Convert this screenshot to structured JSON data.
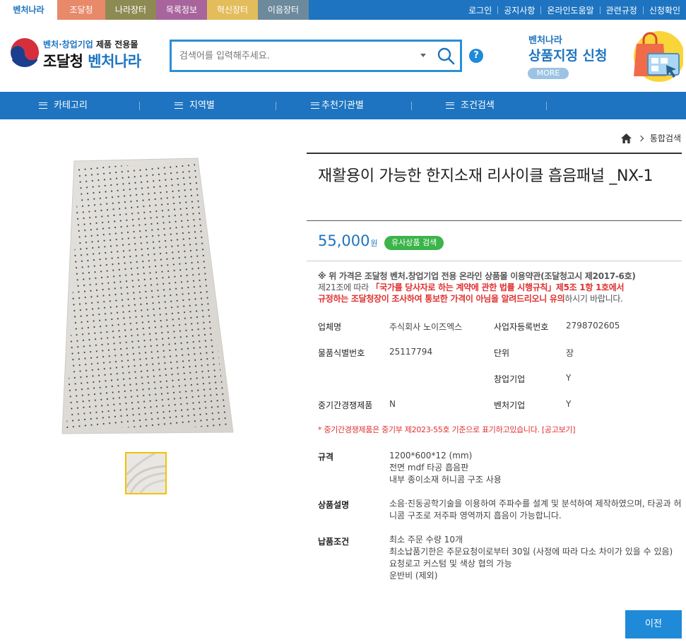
{
  "site_tabs": [
    {
      "label": "벤처나라",
      "color": "#ffffff",
      "active": true
    },
    {
      "label": "조달청",
      "color": "#e8896a"
    },
    {
      "label": "나라장터",
      "color": "#8e8a54"
    },
    {
      "label": "목록정보",
      "color": "#a8649c"
    },
    {
      "label": "혁신장터",
      "color": "#e3bd5c"
    },
    {
      "label": "이음장터",
      "color": "#6d8a9c"
    }
  ],
  "top_links": [
    "로그인",
    "공지사항",
    "온라인도움말",
    "관련규정",
    "신청확인"
  ],
  "logo": {
    "sub_prefix": "벤처·창업기업",
    "sub_suffix": "제품 전용몰",
    "main_prefix": "조달청",
    "main_suffix": "벤처나라"
  },
  "search": {
    "placeholder": "검색어를 입력해주세요.",
    "value": ""
  },
  "help_label": "?",
  "promo": {
    "small": "벤처나라",
    "big": "상품지정 신청",
    "more": "MORE"
  },
  "nav": [
    {
      "label": "카테고리"
    },
    {
      "label": "지역별"
    },
    {
      "label": "추천기관별"
    },
    {
      "label": "조건검색"
    }
  ],
  "breadcrumb": {
    "current": "통합검색"
  },
  "product": {
    "title": "재활용이 가능한 한지소재 리사이클 흡음패널 _NX-1",
    "price": "55,000",
    "price_unit": "원",
    "similar_button": "유사상품 검색"
  },
  "notice": {
    "p1": "※ 위 가격은 조달청 벤처.창업기업 전용 온라인 상품몰 이용약관(조달청고시 제2017-6호)",
    "p2a": "제21조에 따라 ",
    "p2b": "「국가를 당사자로 하는 계약에 관한 법률 시행규칙」제5조 1항 1호에서",
    "p3a": "규정하는 조달청장이 조사하여 통보한 가격이 아님을 알려드리오니 유의",
    "p3b": "하시기 바랍니다."
  },
  "specs": {
    "company_label": "업체명",
    "company_value": "주식회사 노이즈엑스",
    "bizno_label": "사업자등록번호",
    "bizno_value": "2798702605",
    "itemno_label": "물품식별번호",
    "itemno_value": "25117794",
    "unit_label": "단위",
    "unit_value": "장",
    "startup_label": "창업기업",
    "startup_value": "Y",
    "competition_label": "중기간경쟁제품",
    "competition_value": "N",
    "venture_label": "벤처기업",
    "venture_value": "Y"
  },
  "red_note": "* 중기간경쟁제품은 중기부 제2023-55호 기준으로 표기하고있습니다. [공고보기]",
  "details": {
    "spec_label": "규격",
    "spec_lines": [
      "1200*600*12 (mm)",
      "전면 mdf 타공 흡음판",
      "내부 종이소재 허니콤 구조 사용"
    ],
    "desc_label": "상품설명",
    "desc_text": "소음·진동공학기술을 이용하여 주파수를 설계 및 분석하여 제작하였으며, 타공과 허니콤 구조로 저주파 영역까지 흡음이 가능합니다.",
    "delivery_label": "납품조건",
    "delivery_lines": [
      "최소 주문 수량 10개",
      "최소납품기한은 주문요청이로부터 30일 (사정에 따라 다소 차이가 있을 수 있음)",
      "요청로고 커스텀 및 색상 협의 가능",
      "운반비 (제외)"
    ]
  },
  "prev_button": "이전"
}
